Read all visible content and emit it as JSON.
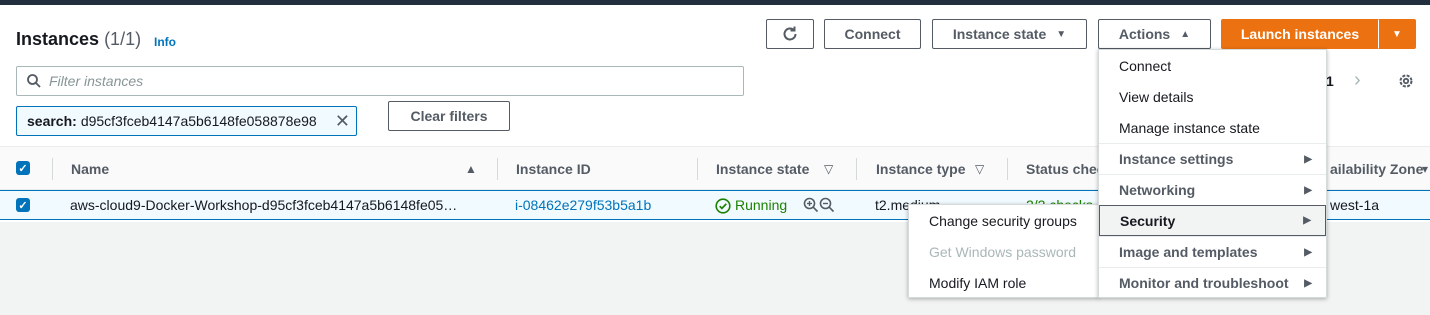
{
  "header": {
    "title": "Instances",
    "count": "(1/1)",
    "info": "Info"
  },
  "toolbar": {
    "refresh_icon": "refresh-icon",
    "connect": "Connect",
    "instance_state": "Instance state",
    "actions": "Actions",
    "launch": "Launch instances"
  },
  "search": {
    "placeholder": "Filter instances"
  },
  "filter_token": {
    "key": "search:",
    "value": "d95cf3fceb4147a5b6148fe058878e98"
  },
  "clear_filters": "Clear filters",
  "pagination": {
    "page": "1"
  },
  "table": {
    "columns": [
      "Name",
      "Instance ID",
      "Instance state",
      "Instance type",
      "Status chec",
      "ailability Zone"
    ],
    "row": {
      "name": "aws-cloud9-Docker-Workshop-d95cf3fceb4147a5b6148fe05…",
      "instance_id": "i-08462e279f53b5a1b",
      "state": "Running",
      "type": "t2.medium",
      "status": "2/2 checks",
      "zone": "west-1a"
    }
  },
  "actions_menu": {
    "items": [
      "Connect",
      "View details",
      "Manage instance state",
      "Instance settings",
      "Networking",
      "Security",
      "Image and templates",
      "Monitor and troubleshoot"
    ]
  },
  "security_submenu": {
    "items": [
      "Change security groups",
      "Get Windows password",
      "Modify IAM role"
    ]
  },
  "colors": {
    "accent": "#0073bb",
    "primary": "#ec7211",
    "running": "#1d8102"
  }
}
